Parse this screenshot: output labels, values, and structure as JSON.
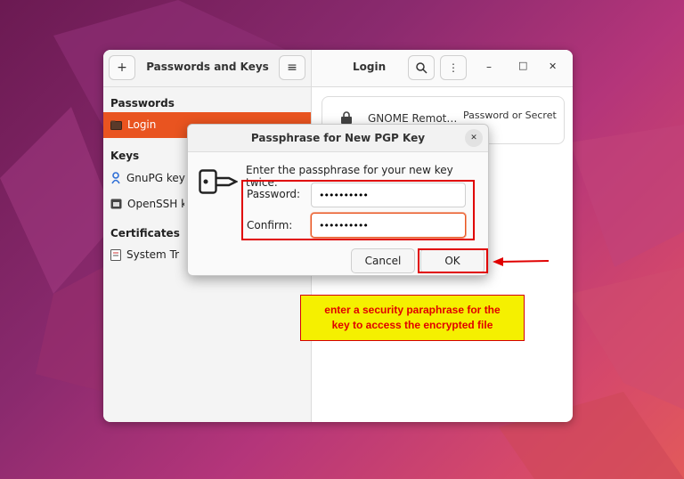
{
  "window": {
    "title": "Passwords and Keys",
    "right_title": "Login",
    "add_icon": "plus-icon",
    "menu_icon": "hamburger-icon",
    "search_icon": "search-icon",
    "more_icon": "kebab-icon",
    "minimize_label": "–",
    "maximize_label": "□",
    "close_label": "✕"
  },
  "sidebar": {
    "sections": [
      {
        "label": "Passwords",
        "items": [
          {
            "label": "Login",
            "icon": "folder-icon",
            "selected": true
          }
        ]
      },
      {
        "label": "Keys",
        "items": [
          {
            "label": "GnuPG keys",
            "icon": "key-person-icon"
          },
          {
            "label": "OpenSSH keys",
            "icon": "ssh-icon"
          }
        ]
      },
      {
        "label": "Certificates",
        "items": [
          {
            "label": "System Trust",
            "icon": "certificate-icon"
          }
        ]
      }
    ]
  },
  "main": {
    "card_name": "GNOME Remot…",
    "card_type": "Password or Secret"
  },
  "dialog": {
    "title": "Passphrase for New PGP Key",
    "prompt": "Enter the passphrase for your new key twice.",
    "password_label": "Password:",
    "password_value": "••••••••••",
    "confirm_label": "Confirm:",
    "confirm_value": "••••••••••",
    "cancel_label": "Cancel",
    "ok_label": "OK",
    "close_label": "✕"
  },
  "annotation": {
    "line1": "enter a security paraphrase for the",
    "line2": "key to access the encrypted file"
  },
  "colors": {
    "accent": "#e95420",
    "annotation_bg": "#f5f000",
    "annotation_text": "#e00000",
    "highlight": "#e00000"
  }
}
